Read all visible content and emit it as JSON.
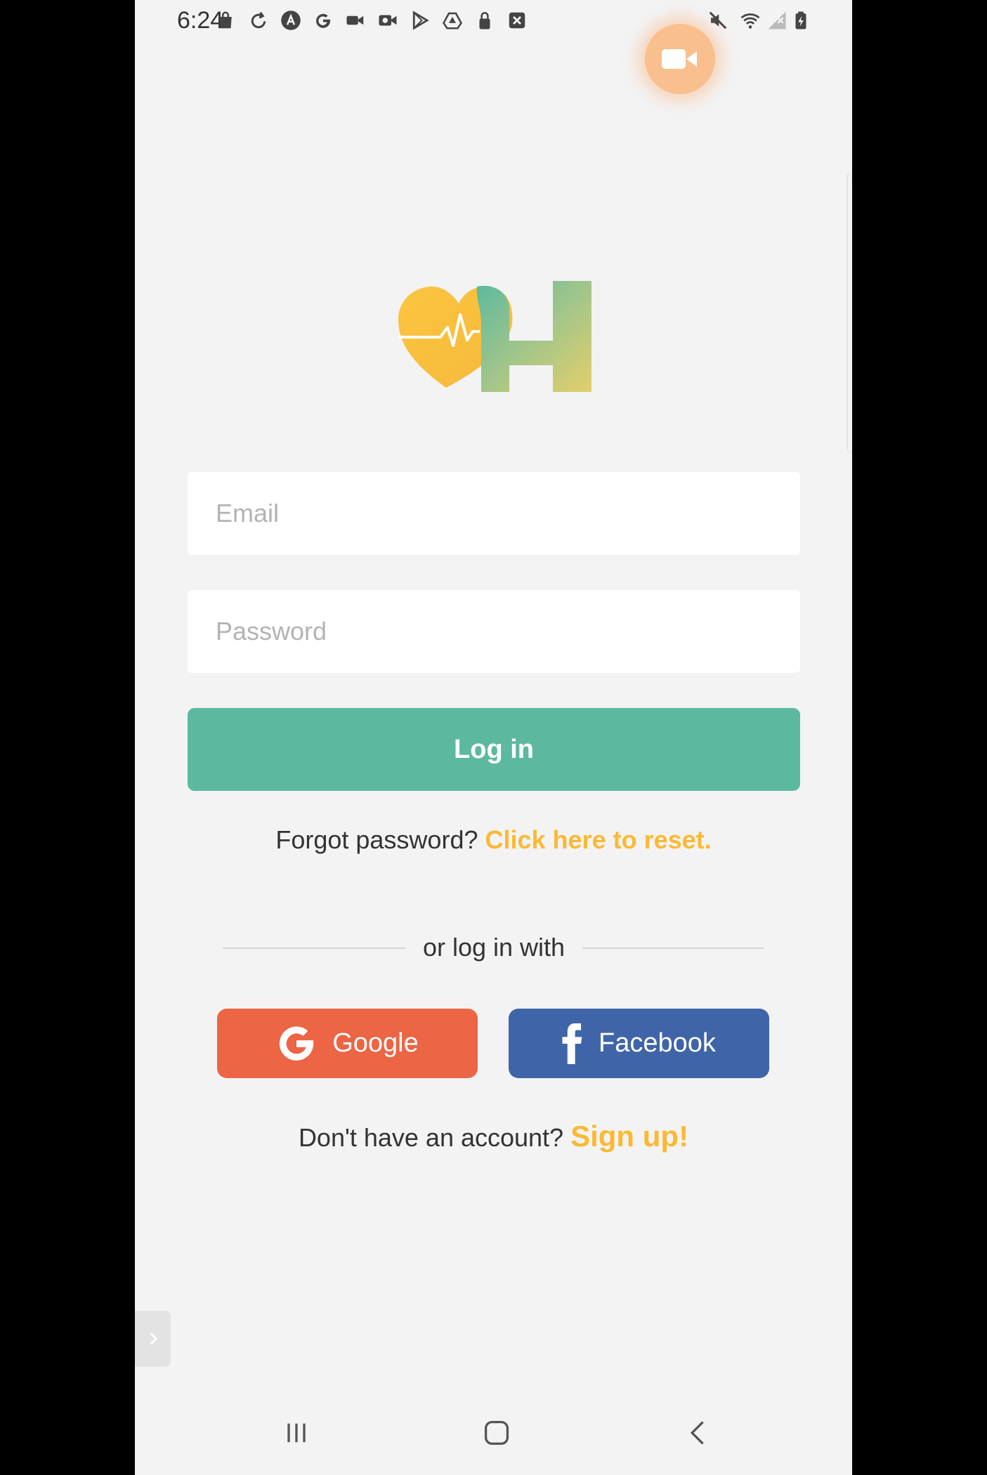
{
  "status_bar": {
    "time": "6:24",
    "left_icons": [
      "shopping-bag-icon",
      "refresh-icon",
      "a-circle-icon",
      "google-g-icon",
      "video-camera-icon",
      "video-record-icon",
      "play-store-icon",
      "drive-icon",
      "lock-icon",
      "close-box-icon"
    ],
    "right_icons": [
      "mute-icon",
      "wifi-icon",
      "no-signal-icon",
      "battery-charging-icon"
    ]
  },
  "floating_record": {
    "icon": "video-camera-icon",
    "color": "#f9bf8e"
  },
  "logo": {
    "icon": "heart-pulse-h-logo",
    "colors": [
      "#fbc540",
      "#5cb99f"
    ]
  },
  "form": {
    "email_placeholder": "Email",
    "password_placeholder": "Password",
    "login_label": "Log in"
  },
  "forgot": {
    "text": "Forgot password?",
    "link": "Click here to reset."
  },
  "divider": {
    "text": "or log in with"
  },
  "social": {
    "google_label": "Google",
    "facebook_label": "Facebook",
    "google_color": "#ec6544",
    "facebook_color": "#3f65a8"
  },
  "signup": {
    "text": "Don't have an account?",
    "link": "Sign up!"
  },
  "colors": {
    "primary": "#5cb99f",
    "accent": "#fbb934",
    "background": "#f3f3f3"
  },
  "nav_bar": {
    "buttons": [
      "recents-icon",
      "home-icon",
      "back-icon"
    ]
  }
}
